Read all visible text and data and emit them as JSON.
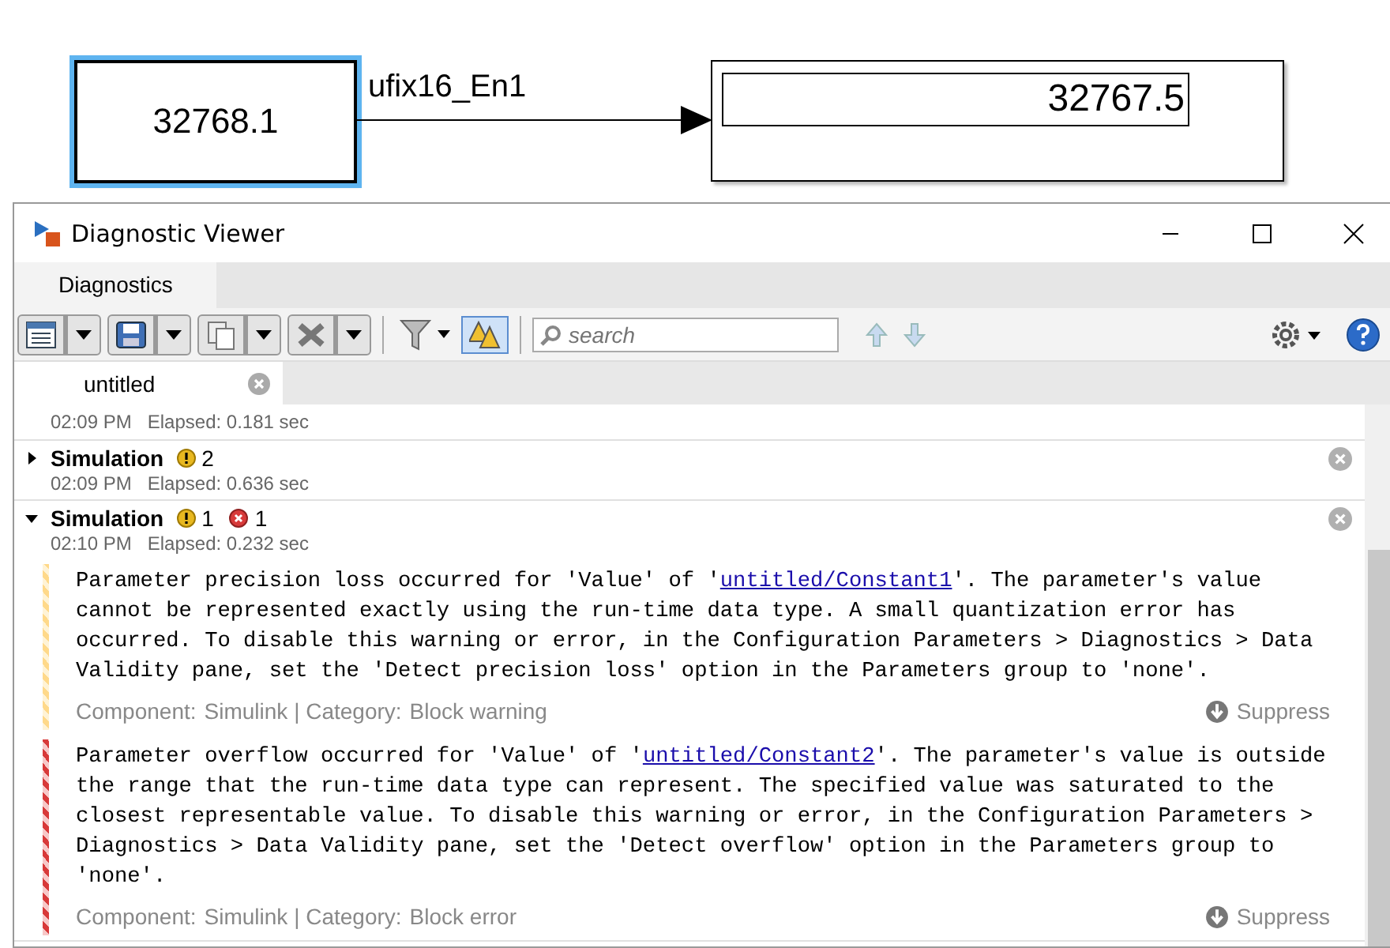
{
  "canvas": {
    "source_block": {
      "value": "32768.1",
      "selected": true
    },
    "signal_label": "ufix16_En1",
    "display_block": {
      "value": "32767.5"
    }
  },
  "window": {
    "title": "Diagnostic Viewer"
  },
  "tabs": [
    {
      "label": "Diagnostics",
      "selected": true
    }
  ],
  "toolbar": {
    "highlight_toggle": {
      "on": true
    },
    "search": {
      "placeholder": "search"
    }
  },
  "documents": [
    {
      "label": "untitled",
      "selected": true
    }
  ],
  "runs": [
    {
      "kind": "partial",
      "time": "02:09 PM",
      "elapsed": "Elapsed: 0.181 sec"
    },
    {
      "kind": "full",
      "title": "Simulation",
      "expanded": false,
      "warnings": "2",
      "time": "02:09 PM",
      "elapsed": "Elapsed: 0.636 sec"
    },
    {
      "kind": "full",
      "title": "Simulation",
      "expanded": true,
      "warnings": "1",
      "errors": "1",
      "time": "02:10 PM",
      "elapsed": "Elapsed: 0.232 sec",
      "messages": [
        {
          "kind": "warning",
          "before": "Parameter precision loss occurred for 'Value' of '",
          "link": "untitled/Constant1",
          "after": "'. The parameter's value cannot be represented exactly using the run-time data type. A small quantization error has occurred. To disable this warning or error, in the Configuration Parameters > Diagnostics > Data Validity pane, set the 'Detect precision loss' option in the Parameters group to 'none'.",
          "component_label": "Component:",
          "component": "Simulink | Category:",
          "category": "Block warning",
          "suppress": "Suppress"
        },
        {
          "kind": "error",
          "before": "Parameter overflow occurred for 'Value' of '",
          "link": "untitled/Constant2",
          "after": "'. The parameter's value is outside the range that the run-time data type can represent. The specified value was saturated to the closest representable value. To disable this warning or error, in the Configuration Parameters > Diagnostics > Data Validity pane, set the 'Detect overflow' option in the Parameters group to 'none'.",
          "component_label": "Component:",
          "component": "Simulink | Category:",
          "category": "Block error",
          "suppress": "Suppress"
        }
      ]
    }
  ]
}
